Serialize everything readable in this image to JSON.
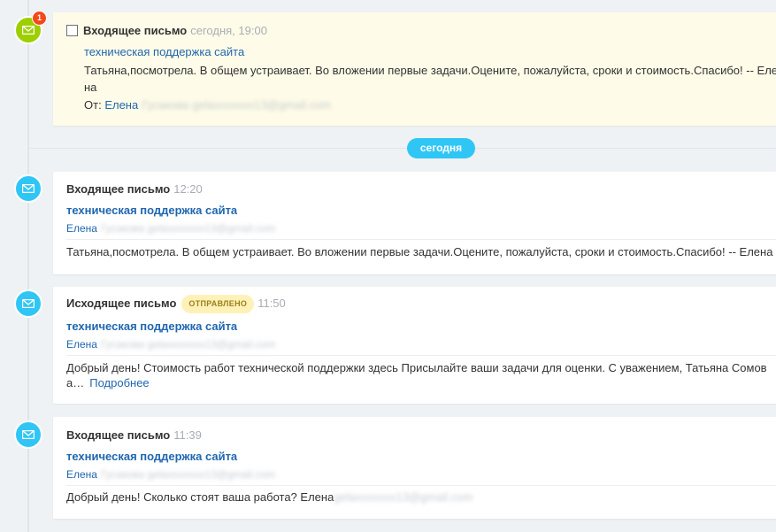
{
  "colors": {
    "accent": "#2fc6f6",
    "pending_icon": "#9dcf00",
    "badge": "#f54819",
    "link": "#2067b0"
  },
  "pending": {
    "counter": "1",
    "title": "Входящее письмо",
    "time": "сегодня, 19:00",
    "subject": "техническая поддержка сайта",
    "body_line1": "Татьяна,посмотрела. В общем устраивает. Во вложении первые задачи.Оцените, пожалуйста, сроки и стоимость.Спасибо! -- Елена",
    "body_line2": "на",
    "from_label": "От:",
    "from_name": "Елена",
    "from_email_blurred": "Гусакова gelaxxxxxxx13@gmail.com"
  },
  "day_separator": "сегодня",
  "items": [
    {
      "title": "Входящее письмо",
      "time": "12:20",
      "subject": "техническая поддержка сайта",
      "sender": "Елена",
      "sender_blurred": "Гусакова gelaxxxxxxx13@gmail.com",
      "body": "Татьяна,посмотрела. В общем устраивает. Во вложении первые задачи.Оцените, пожалуйста, сроки и стоимость.Спасибо! -- Елена"
    },
    {
      "title": "Исходящее письмо",
      "status": "ОТПРАВЛЕНО",
      "time": "11:50",
      "subject": "техническая поддержка сайта",
      "sender": "Елена",
      "sender_blurred": "Гусакова gelaxxxxxxx13@gmail.com",
      "body_line1": "Добрый день! Стоимость работ технической поддержки здесь Присылайте ваши задачи для оценки. С уважением, Татьяна Сомов",
      "body_line2": "а…",
      "more": "Подробнее"
    },
    {
      "title": "Входящее письмо",
      "time": "11:39",
      "subject": "техническая поддержка сайта",
      "sender": "Елена",
      "sender_blurred": "Гусакова gelaxxxxxxx13@gmail.com",
      "body": "Добрый день! Сколько стоят ваша работа? Елена",
      "body_blurred": "gelaxxxxxxx13@gmail.com"
    }
  ],
  "icons": {
    "mail": "mail-icon"
  }
}
